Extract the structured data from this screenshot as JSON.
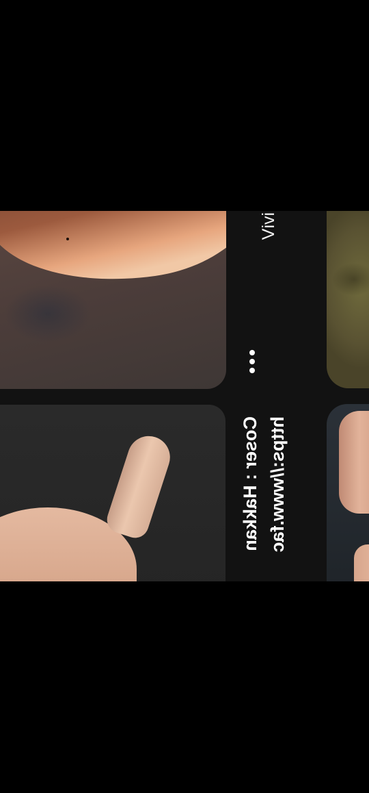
{
  "feed": {
    "pins": [
      {
        "caption": "iviV"
      },
      {
        "caption_url": "https://www.fac",
        "caption_cosplay": "Coser : Hakkan"
      }
    ]
  },
  "icons": {
    "more": "more-options-icon"
  },
  "colors": {
    "background": "#000000",
    "feed_background": "#121212",
    "text": "#ffffff"
  }
}
